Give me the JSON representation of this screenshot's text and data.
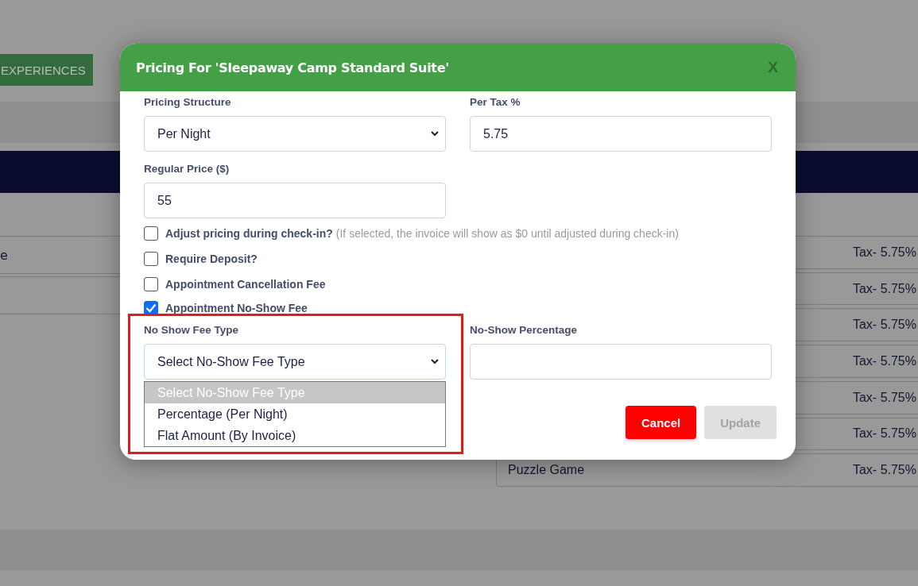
{
  "page": {
    "nav_button": "EXPERIENCES",
    "left_rows": [
      {
        "text": "e"
      },
      {}
    ],
    "right_rows": [
      {
        "tax": "Tax- 5.75%"
      },
      {
        "tax": "Tax- 5.75%"
      },
      {
        "tax": "Tax- 5.75%"
      },
      {
        "tax": "Tax- 5.75%"
      },
      {
        "tax": "Tax- 5.75%"
      },
      {
        "tax": "Tax- 5.75%"
      },
      {
        "name": "Puzzle Game",
        "tax": "Tax- 5.75%"
      }
    ]
  },
  "modal": {
    "title": "Pricing For 'Sleepaway Camp Standard Suite'",
    "close": "X",
    "pricing_structure": {
      "label": "Pricing Structure",
      "value": "Per Night"
    },
    "per_tax": {
      "label": "Per Tax %",
      "value": "5.75"
    },
    "regular_price": {
      "label": "Regular Price ($)",
      "value": "55"
    },
    "checkboxes": [
      {
        "label": "Adjust pricing during check-in?",
        "note": "(If selected, the invoice will show as $0 until adjusted during check-in)",
        "checked": false
      },
      {
        "label": "Require Deposit?",
        "checked": false
      },
      {
        "label": "Appointment Cancellation Fee",
        "checked": false
      },
      {
        "label": "Appointment No-Show Fee",
        "checked": true
      }
    ],
    "no_show_fee_type": {
      "label": "No Show Fee Type",
      "value": "Select No-Show Fee Type",
      "highlighted": true,
      "options": [
        {
          "label": "Select No-Show Fee Type",
          "selected": true
        },
        {
          "label": "Percentage (Per Night)",
          "selected": false
        },
        {
          "label": "Flat Amount (By Invoice)",
          "selected": false
        }
      ]
    },
    "no_show_percentage": {
      "label": "No-Show Percentage"
    },
    "cancel": {
      "label": "Cancel"
    },
    "update": {
      "label": "Update",
      "disabled": true
    }
  }
}
